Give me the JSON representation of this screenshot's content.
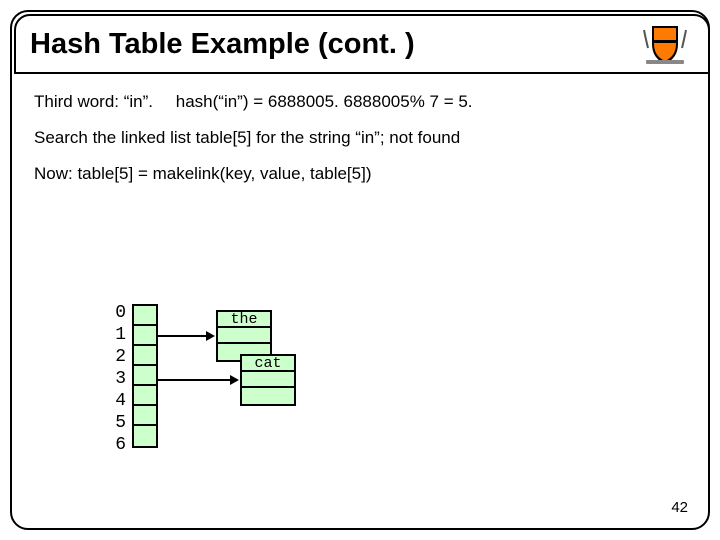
{
  "title": "Hash Table Example (cont. )",
  "lines": {
    "l1a": "Third word:  “in”.",
    "l1b": "hash(“in”) = 6888005.  6888005% 7 = 5.",
    "l2": "Search the linked list   table[5]  for the string “in”; not found",
    "l3": "Now:   table[5] = makelink(key, value, table[5])"
  },
  "indices": [
    "0",
    "1",
    "2",
    "3",
    "4",
    "5",
    "6"
  ],
  "nodes": {
    "n1": "the",
    "n2": "cat"
  },
  "pageNumber": "42"
}
